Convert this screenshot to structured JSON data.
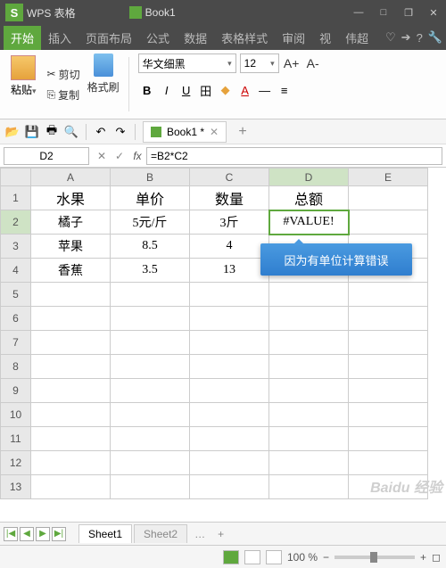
{
  "title": {
    "app_badge": "S",
    "app_name": "WPS 表格",
    "doc": "Book1"
  },
  "win": {
    "min": "—",
    "sq": "□",
    "max": "❐",
    "close": "✕"
  },
  "menu": {
    "items": [
      "开始",
      "插入",
      "页面布局",
      "公式",
      "数据",
      "表格样式",
      "审阅",
      "视",
      "伟超"
    ],
    "active_index": 0
  },
  "menu_icons": {
    "heart": "♡",
    "arrow": "➔",
    "q": "?",
    "wrench": "🔧"
  },
  "ribbon": {
    "paste": "粘贴",
    "cut": "剪切",
    "copy": "复制",
    "format_painter": "格式刷",
    "font_name": "华文细黑",
    "font_size": "12",
    "bold": "B",
    "italic": "I",
    "underline": "U",
    "border": "田",
    "fill": "◆",
    "font_color": "A",
    "line": "—",
    "line2": "≡",
    "inc": "A+",
    "dec": "A-"
  },
  "qat": {
    "open": "📂",
    "save": "💾",
    "print": "🖶",
    "preview": "🔍",
    "undo": "↶",
    "redo": "↷"
  },
  "doc_tab": {
    "label": "Book1 *",
    "close": "✕",
    "plus": "+"
  },
  "formula": {
    "cell": "D2",
    "cancel": "✕",
    "ok": "✓",
    "fx": "fx",
    "value": "=B2*C2"
  },
  "cols": [
    "A",
    "B",
    "C",
    "D",
    "E"
  ],
  "selected_col": "D",
  "selected_row": 2,
  "rows": [
    {
      "n": 1,
      "c": [
        "水果",
        "单价",
        "数量",
        "总额",
        ""
      ]
    },
    {
      "n": 2,
      "c": [
        "橘子",
        "5元/斤",
        "3斤",
        "#VALUE!",
        ""
      ]
    },
    {
      "n": 3,
      "c": [
        "苹果",
        "8.5",
        "4",
        "",
        ""
      ]
    },
    {
      "n": 4,
      "c": [
        "香蕉",
        "3.5",
        "13",
        "",
        ""
      ]
    },
    {
      "n": 5,
      "c": [
        "",
        "",
        "",
        "",
        ""
      ]
    },
    {
      "n": 6,
      "c": [
        "",
        "",
        "",
        "",
        ""
      ]
    },
    {
      "n": 7,
      "c": [
        "",
        "",
        "",
        "",
        ""
      ]
    },
    {
      "n": 8,
      "c": [
        "",
        "",
        "",
        "",
        ""
      ]
    },
    {
      "n": 9,
      "c": [
        "",
        "",
        "",
        "",
        ""
      ]
    },
    {
      "n": 10,
      "c": [
        "",
        "",
        "",
        "",
        ""
      ]
    },
    {
      "n": 11,
      "c": [
        "",
        "",
        "",
        "",
        ""
      ]
    },
    {
      "n": 12,
      "c": [
        "",
        "",
        "",
        "",
        ""
      ]
    },
    {
      "n": 13,
      "c": [
        "",
        "",
        "",
        "",
        ""
      ]
    }
  ],
  "callout": "因为有单位计算错误",
  "sheets": {
    "nav": [
      "|◀",
      "◀",
      "▶",
      "▶|"
    ],
    "tabs": [
      "Sheet1",
      "Sheet2"
    ],
    "more": "…",
    "plus": "+"
  },
  "status": {
    "zoom": "100 %",
    "minus": "−",
    "plus": "+",
    "square": "◻"
  },
  "watermark": "Baidu 经验"
}
